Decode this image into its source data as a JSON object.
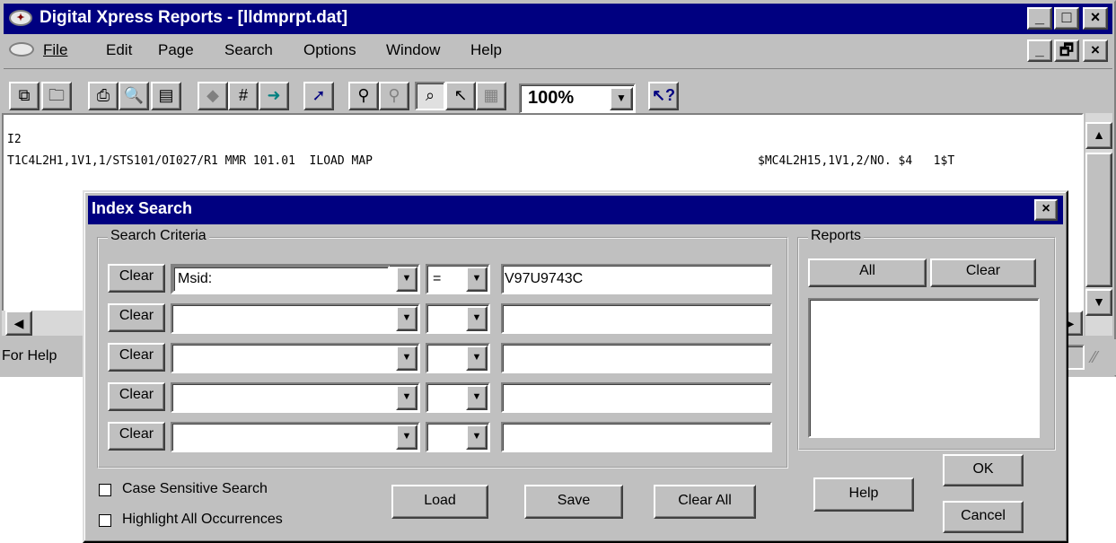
{
  "app": {
    "title": "Digital Xpress Reports - [lldmprpt.dat]",
    "caption_buttons": [
      "_",
      "□",
      "×"
    ]
  },
  "menu": {
    "items": [
      {
        "label": "File"
      },
      {
        "label": "Edit"
      },
      {
        "label": "Page"
      },
      {
        "label": "Search"
      },
      {
        "label": "Options"
      },
      {
        "label": "Window"
      },
      {
        "label": "Help"
      }
    ],
    "mdi_buttons": [
      "_",
      "🗗",
      "×"
    ]
  },
  "toolbar": {
    "zoom": "100%",
    "icons": [
      "open-pages-icon",
      "folder-icon",
      "print-icon",
      "print-preview-icon",
      "page-setup-icon",
      "prev-page-icon",
      "goto-page-icon",
      "next-page-icon",
      "bookmark-icon",
      "find-icon",
      "find-next-icon",
      "zoom-icon",
      "pointer-icon",
      "grid-icon",
      "help-pointer-icon"
    ]
  },
  "report": {
    "line1": "I2",
    "line2_left": "T1C4L2H1,1V1,1/STS101/OI027/R1 MMR 101.01  ILOAD MAP",
    "line2_right": "$MC4L2H15,1V1,2/NO. $4   1$T"
  },
  "statusbar": {
    "text": "For Help"
  },
  "dialog": {
    "title": "Index Search",
    "criteria_group_label": "Search Criteria",
    "reports_group_label": "Reports",
    "rows": [
      {
        "clear": "Clear",
        "field": "Msid:",
        "op": "=",
        "value": "V97U9743C"
      },
      {
        "clear": "Clear",
        "field": "",
        "op": "",
        "value": ""
      },
      {
        "clear": "Clear",
        "field": "",
        "op": "",
        "value": ""
      },
      {
        "clear": "Clear",
        "field": "",
        "op": "",
        "value": ""
      },
      {
        "clear": "Clear",
        "field": "",
        "op": "",
        "value": ""
      }
    ],
    "reports_all": "All",
    "reports_clear": "Clear",
    "case_sensitive": {
      "label": "Case Sensitive Search",
      "checked": false
    },
    "highlight_all": {
      "label": "Highlight All Occurrences",
      "checked": false
    },
    "load": "Load",
    "save": "Save",
    "clear_all": "Clear All",
    "help": "Help",
    "ok": "OK",
    "cancel": "Cancel"
  }
}
